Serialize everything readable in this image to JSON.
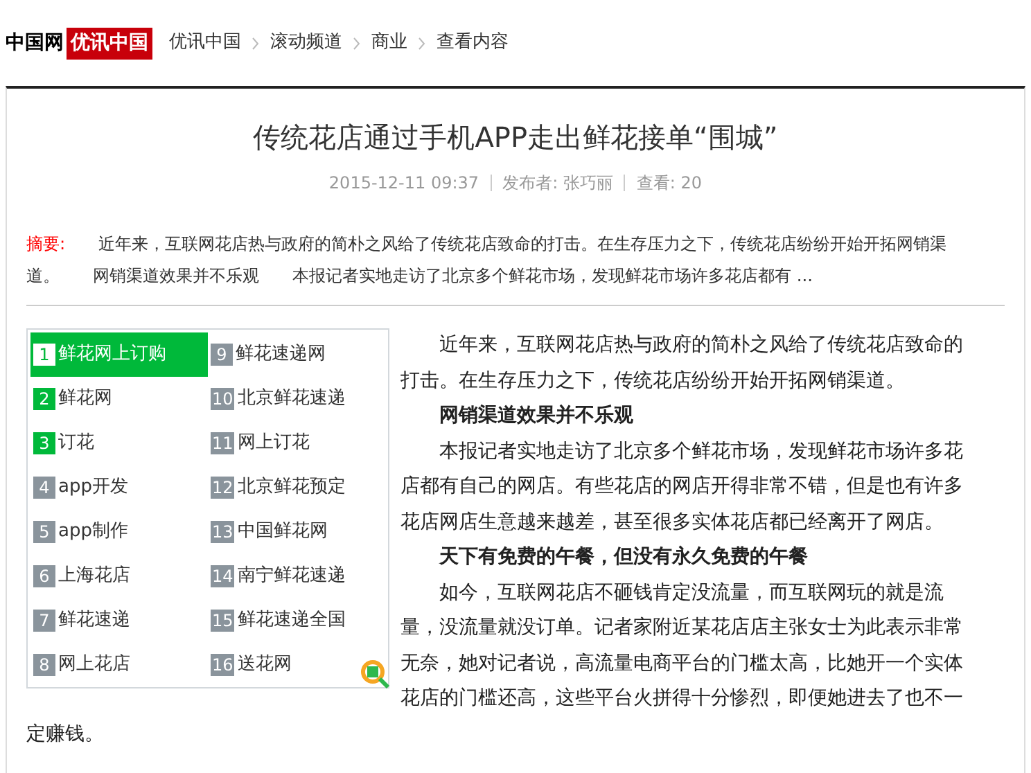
{
  "header": {
    "logo_text": "中国网",
    "logo_badge": "优讯中国",
    "breadcrumb": [
      "优讯中国",
      "滚动频道",
      "商业",
      "查看内容"
    ]
  },
  "article": {
    "title": "传统花店通过手机APP走出鲜花接单“围城”",
    "meta": [
      "2015-12-11 09:37",
      "发布者: 张巧丽",
      "查看: 20"
    ],
    "abstract_label": "摘要:",
    "abstract": "近年来，互联网花店热与政府的简朴之风给了传统花店致命的打击。在生存压力之下，传统花店纷纷开始开拓网销渠道。　　网销渠道效果并不乐观　　本报记者实地走访了北京多个鲜花市场，发现鲜花市场许多花店都有 ..."
  },
  "ranking": [
    {
      "rank": "1",
      "label": "鲜花网上订购",
      "kind": "top",
      "selected": true
    },
    {
      "rank": "2",
      "label": "鲜花网",
      "kind": "top",
      "selected": false
    },
    {
      "rank": "3",
      "label": "订花",
      "kind": "top",
      "selected": false
    },
    {
      "rank": "4",
      "label": "app开发",
      "kind": "normal",
      "selected": false
    },
    {
      "rank": "5",
      "label": "app制作",
      "kind": "normal",
      "selected": false
    },
    {
      "rank": "6",
      "label": "上海花店",
      "kind": "normal",
      "selected": false
    },
    {
      "rank": "7",
      "label": "鲜花速递",
      "kind": "normal",
      "selected": false
    },
    {
      "rank": "8",
      "label": "网上花店",
      "kind": "normal",
      "selected": false
    },
    {
      "rank": "9",
      "label": "鲜花速递网",
      "kind": "normal",
      "selected": false
    },
    {
      "rank": "10",
      "label": "北京鲜花速递",
      "kind": "normal",
      "selected": false
    },
    {
      "rank": "11",
      "label": "网上订花",
      "kind": "normal",
      "selected": false
    },
    {
      "rank": "12",
      "label": "北京鲜花预定",
      "kind": "normal",
      "selected": false
    },
    {
      "rank": "13",
      "label": "中国鲜花网",
      "kind": "normal",
      "selected": false
    },
    {
      "rank": "14",
      "label": "南宁鲜花速递",
      "kind": "normal",
      "selected": false
    },
    {
      "rank": "15",
      "label": "鲜花速递全国",
      "kind": "normal",
      "selected": false
    },
    {
      "rank": "16",
      "label": "送花网",
      "kind": "normal",
      "selected": false
    }
  ],
  "paragraphs": [
    {
      "kind": "text",
      "text": "近年来，互联网花店热与政府的简朴之风给了传统花店致命的打击。在生存压力之下，传统花店纷纷开始开拓网销渠道。"
    },
    {
      "kind": "heading",
      "text": "网销渠道效果并不乐观"
    },
    {
      "kind": "text",
      "text": "本报记者实地走访了北京多个鲜花市场，发现鲜花市场许多花店都有自己的网店。有些花店的网店开得非常不错，但是也有许多花店网店生意越来越差，甚至很多实体花店都已经离开了网店。"
    },
    {
      "kind": "heading",
      "text": "天下有免费的午餐，但没有永久免费的午餐"
    },
    {
      "kind": "text",
      "text": "如今，互联网花店不砸钱肯定没流量，而互联网玩的就是流量，没流量就没订单。记者家附近某花店店主张女士为此表示非常无奈，她对记者说，高流量电商平台的门槛太高，比她开一个实体花店的门槛还高，这些平台火拼得十分惨烈，即便她进去了也不一"
    },
    {
      "kind": "continuation",
      "text": "定赚钱。"
    }
  ]
}
